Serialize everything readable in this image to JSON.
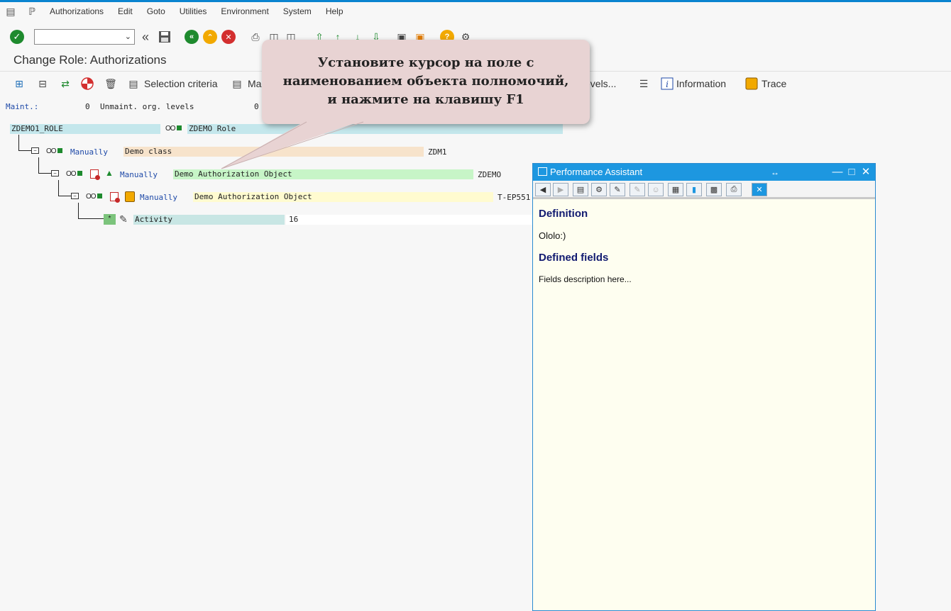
{
  "menu": {
    "items": [
      {
        "label": "Authorizations"
      },
      {
        "label": "Edit"
      },
      {
        "label": "Goto"
      },
      {
        "label": "Utilities"
      },
      {
        "label": "Environment"
      },
      {
        "label": "System"
      },
      {
        "label": "Help"
      }
    ]
  },
  "toolbar": {
    "command_value": ""
  },
  "page": {
    "title": "Change Role: Authorizations"
  },
  "app_toolbar": {
    "selection_criteria": "Selection criteria",
    "manually_partial": "Ma",
    "org_levels_partial": "evels...",
    "information": "Information",
    "trace": "Trace"
  },
  "status": {
    "maint_label": "Maint.:",
    "maint_value": "0",
    "unmaint_label": "Unmaint. org. levels",
    "unmaint_value": "0"
  },
  "tree": {
    "role_id": "ZDEMO1_ROLE",
    "role_desc": "ZDEMO Role",
    "class_status": "Manually",
    "class_desc": "Demo class",
    "class_id": "ZDM1",
    "object_status": "Manually",
    "object_desc": "Demo Authorization Object",
    "object_id": "ZDEMO",
    "auth_status": "Manually",
    "auth_desc": "Demo Authorization Object",
    "auth_id": "T-EP551",
    "field_desc": "Activity",
    "field_value": "16"
  },
  "callout": {
    "line1": "Установите курсор на поле с",
    "line2": "наименованием объекта полномочий,",
    "line3": "и нажмите на клавишу F1"
  },
  "assistant": {
    "title": "Performance Assistant",
    "definition_heading": "Definition",
    "definition_text": "Ololo:)",
    "fields_heading": "Defined fields",
    "fields_text": "Fields description here..."
  },
  "colors": {
    "accent": "#0a84d0",
    "assistant_titlebar": "#1d97e0",
    "ok_green": "#1e8a2e",
    "cancel_red": "#d32f2f",
    "exit_orange": "#f2a900"
  }
}
